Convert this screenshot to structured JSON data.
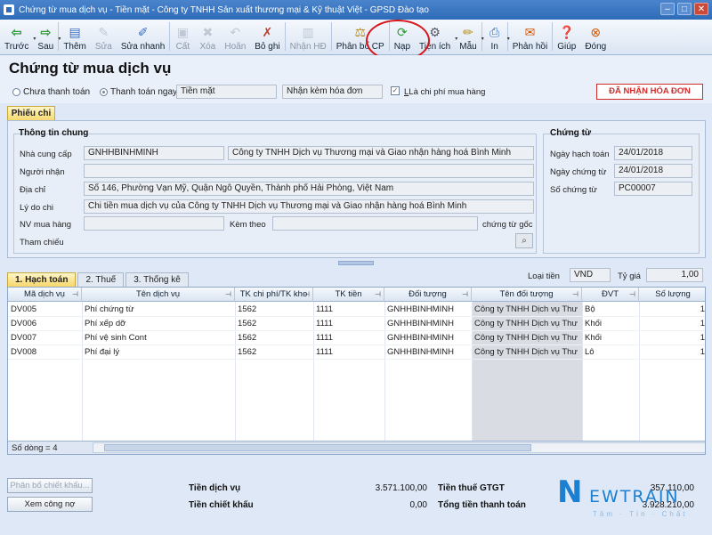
{
  "window": {
    "title": "Chứng từ mua dịch vụ - Tiền mặt - Công ty TNHH Sản xuất thương mại & Kỹ thuật Việt - GPSD Đào tạo"
  },
  "toolbar": {
    "items": [
      {
        "label": "Trước",
        "icon": "arrow-left-icon"
      },
      {
        "label": "Sau",
        "icon": "arrow-right-icon"
      },
      {
        "label": "Thêm",
        "icon": "add-document-icon"
      },
      {
        "label": "Sửa",
        "icon": "edit-icon"
      },
      {
        "label": "Sửa nhanh",
        "icon": "quick-edit-icon"
      },
      {
        "label": "Cất",
        "icon": "save-icon"
      },
      {
        "label": "Xóa",
        "icon": "delete-icon"
      },
      {
        "label": "Hoãn",
        "icon": "undo-icon"
      },
      {
        "label": "Bỏ ghi",
        "icon": "unpost-icon"
      },
      {
        "label": "Nhận HĐ",
        "icon": "receive-invoice-icon"
      },
      {
        "label": "Phân bổ CP",
        "icon": "allocate-cost-icon"
      },
      {
        "label": "Nạp",
        "icon": "reload-icon"
      },
      {
        "label": "Tiện ích",
        "icon": "utilities-icon"
      },
      {
        "label": "Mẫu",
        "icon": "template-icon"
      },
      {
        "label": "In",
        "icon": "print-icon"
      },
      {
        "label": "Phản hồi",
        "icon": "feedback-icon"
      },
      {
        "label": "Giúp",
        "icon": "help-icon"
      },
      {
        "label": "Đóng",
        "icon": "close-icon"
      }
    ]
  },
  "form": {
    "title": "Chứng từ mua dịch vụ",
    "radio_unpaid": "Chưa thanh toán",
    "radio_paid": "Thanh toán ngay",
    "payment_method": "Tiền mặt",
    "invoice_option": "Nhận kèm hóa đơn",
    "purchase_expense": "Là chi phí mua hàng",
    "status": "ĐÃ NHẬN HÓA ĐƠN"
  },
  "voucher_tab": "Phiếu chi",
  "general": {
    "title": "Thông tin chung",
    "supplier_label": "Nhà cung cấp",
    "supplier_code": "GNHHBINHMINH",
    "supplier_name": "Công ty TNHH Dịch vụ Thương mại và Giao nhận hàng hoá Bình Minh",
    "receiver_label": "Người nhận",
    "receiver": "",
    "address_label": "Địa chỉ",
    "address": "Số 146, Phường Vạn Mỹ, Quận Ngô Quyền, Thành phố Hải Phòng, Việt Nam",
    "reason_label": "Lý do chi",
    "reason": "Chi tiền mua dịch vụ của Công ty TNHH Dịch vụ Thương mại và Giao nhận hàng hoá Bình Minh",
    "buyer_label": "NV mua hàng",
    "attach_label": "Kèm theo",
    "original_docs": "chứng từ gốc",
    "reference_label": "Tham chiếu"
  },
  "voucher": {
    "title": "Chứng từ",
    "posting_date_label": "Ngày hạch toán",
    "posting_date": "24/01/2018",
    "voucher_date_label": "Ngày chứng từ",
    "voucher_date": "24/01/2018",
    "voucher_no_label": "Số chứng từ",
    "voucher_no": "PC00007"
  },
  "detail_tabs": [
    {
      "label": "1. Hạch toán"
    },
    {
      "label": "2. Thuế"
    },
    {
      "label": "3. Thống kê"
    }
  ],
  "currency": {
    "label": "Loại tiền",
    "value": "VND",
    "rate_label": "Tỷ giá",
    "rate": "1,00"
  },
  "grid": {
    "columns": [
      "Mã dịch vụ",
      "Tên dịch vụ",
      "TK chi phí/TK kho",
      "TK tiền",
      "Đối tượng",
      "Tên đối tượng",
      "ĐVT",
      "Số lượng"
    ],
    "rows": [
      [
        "DV005",
        "Phí chứng từ",
        "1562",
        "1111",
        "GNHHBINHMINH",
        "Công ty TNHH Dịch vụ Thư",
        "Bộ",
        "1"
      ],
      [
        "DV006",
        "Phí xếp dỡ",
        "1562",
        "1111",
        "GNHHBINHMINH",
        "Công ty TNHH Dịch vụ Thư",
        "Khối",
        "1"
      ],
      [
        "DV007",
        "Phí vệ sinh Cont",
        "1562",
        "1111",
        "GNHHBINHMINH",
        "Công ty TNHH Dịch vụ Thư",
        "Khối",
        "1"
      ],
      [
        "DV008",
        "Phí đại lý",
        "1562",
        "1111",
        "GNHHBINHMINH",
        "Công ty TNHH Dịch vụ Thư",
        "Lô",
        "1"
      ]
    ],
    "row_count": "Số dòng = 4"
  },
  "footer": {
    "allocate_discount": "Phân bổ chiết khấu...",
    "view_debt": "Xem công nợ",
    "service_amount_label": "Tiền dịch vụ",
    "service_amount": "3.571.100,00",
    "discount_label": "Tiền chiết khấu",
    "discount": "0,00",
    "vat_label": "Tiền thuế GTGT",
    "vat": "357.110,00",
    "total_label": "Tổng tiền thanh toán",
    "total": "3.928.210,00"
  },
  "logo": {
    "big": "N",
    "rest": "EWTRAIN",
    "sub": "Tâm · Tín · Chất"
  }
}
